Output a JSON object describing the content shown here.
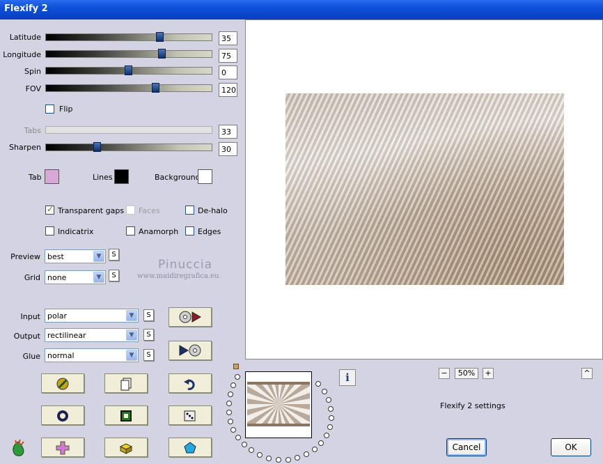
{
  "window": {
    "title": "Flexify 2"
  },
  "sliders": [
    {
      "label": "Latitude",
      "value": "35"
    },
    {
      "label": "Longitude",
      "value": "75"
    },
    {
      "label": "Spin",
      "value": "0"
    },
    {
      "label": "FOV",
      "value": "120"
    },
    {
      "label": "Tabs",
      "value": "33",
      "disabled": true
    },
    {
      "label": "Sharpen",
      "value": "30"
    }
  ],
  "flip": {
    "label": "Flip",
    "checked": false
  },
  "colors": {
    "tab_label": "Tab",
    "tab_color": "#d8a8d8",
    "lines_label": "Lines",
    "lines_color": "#000000",
    "background_label": "Background",
    "background_color": "#ffffff"
  },
  "options": {
    "transparent_gaps": {
      "label": "Transparent gaps",
      "checked": true
    },
    "faces": {
      "label": "Faces",
      "checked": false,
      "disabled": true
    },
    "de_halo": {
      "label": "De-halo",
      "checked": false
    },
    "indicatrix": {
      "label": "Indicatrix",
      "checked": false
    },
    "anamorph": {
      "label": "Anamorph",
      "checked": false
    },
    "edges": {
      "label": "Edges",
      "checked": false
    }
  },
  "preview_quality": {
    "label": "Preview",
    "value": "best"
  },
  "grid": {
    "label": "Grid",
    "value": "none"
  },
  "watermark": {
    "name": "Pinuccia",
    "site": "www.maidiregrafica.eu"
  },
  "projection": {
    "input": {
      "label": "Input",
      "value": "polar"
    },
    "output": {
      "label": "Output",
      "value": "rectilinear"
    },
    "glue": {
      "label": "Glue",
      "value": "normal"
    }
  },
  "s_button_label": "S",
  "info_label": "i",
  "zoom": {
    "minus": "−",
    "value": "50%",
    "plus": "+"
  },
  "up_label": "^",
  "settings_name": "Flexify 2 settings",
  "buttons": {
    "cancel": "Cancel",
    "ok": "OK"
  }
}
